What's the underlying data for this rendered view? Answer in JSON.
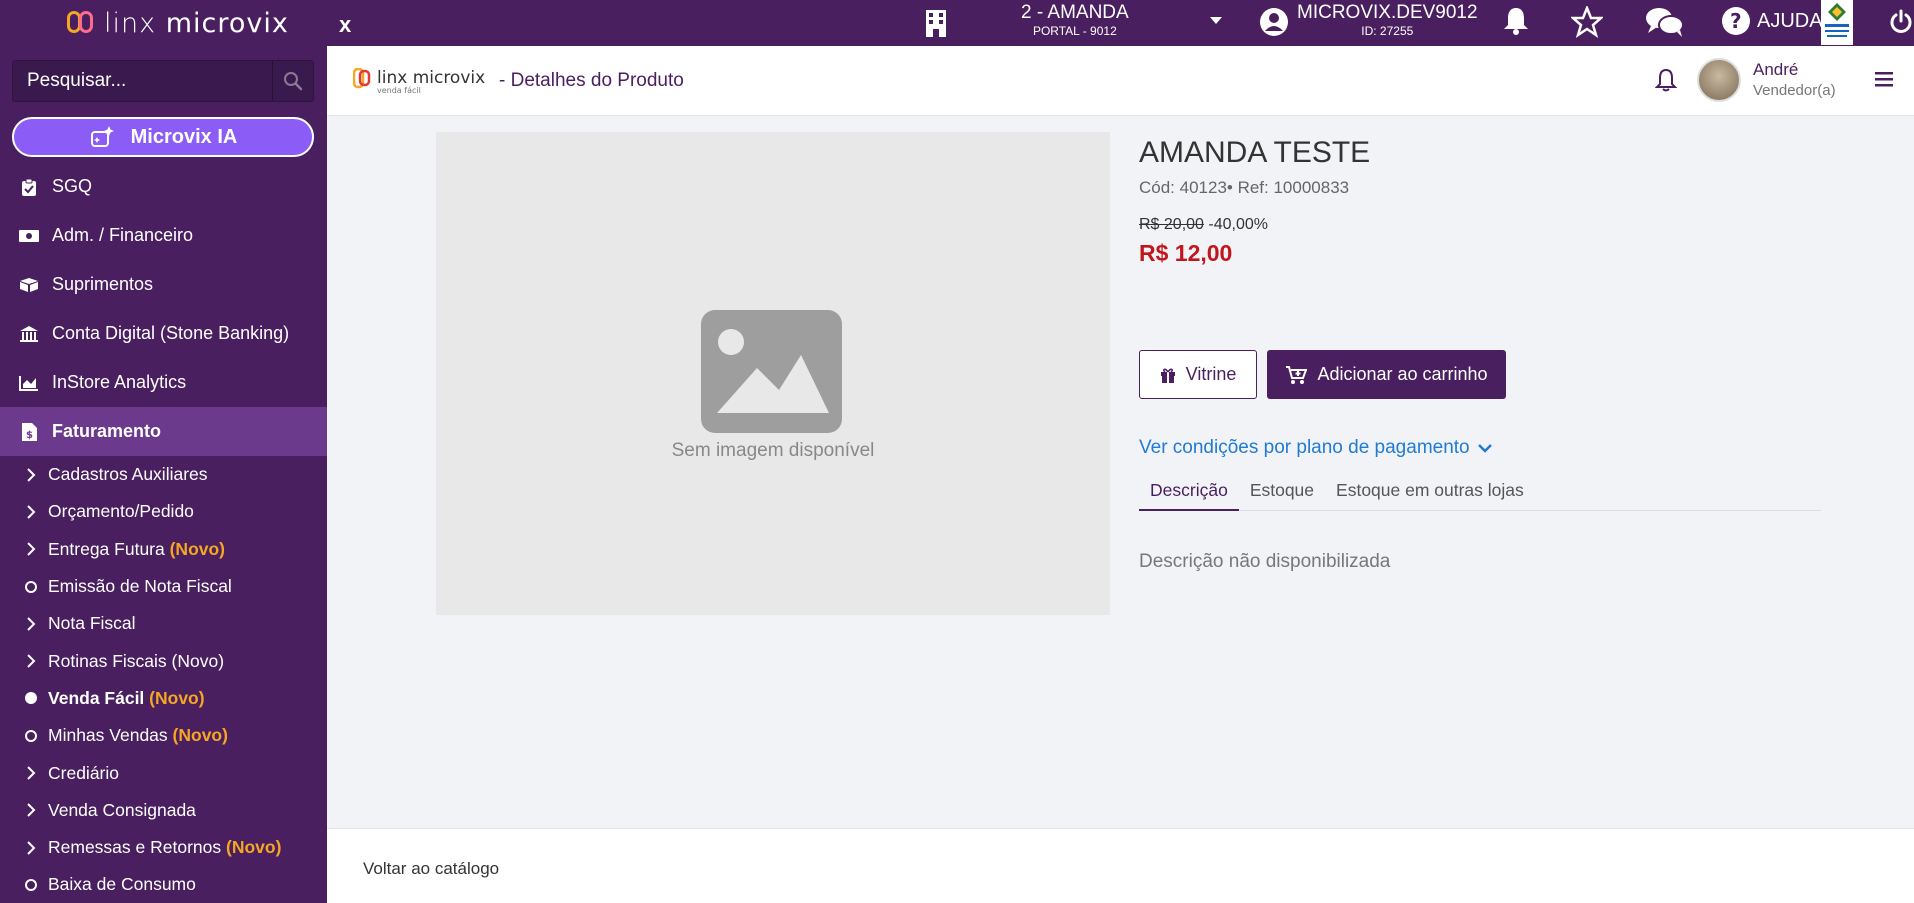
{
  "sidebar": {
    "logo_text_light": "linx",
    "logo_text_bold": "microvix",
    "search_placeholder": "Pesquisar...",
    "ia_label": "Microvix IA",
    "items": [
      {
        "label": "SGQ",
        "icon": "clipboard-check-icon"
      },
      {
        "label": "Adm. / Financeiro",
        "icon": "money-bill-icon"
      },
      {
        "label": "Suprimentos",
        "icon": "boxes-icon"
      },
      {
        "label": "Conta Digital (Stone Banking)",
        "icon": "bank-icon"
      },
      {
        "label": "InStore Analytics",
        "icon": "chart-area-icon"
      },
      {
        "label": "Faturamento",
        "icon": "invoice-icon"
      }
    ],
    "sub_items": [
      {
        "label": "Cadastros Auxiliares",
        "novo": ""
      },
      {
        "label": "Orçamento/Pedido",
        "novo": ""
      },
      {
        "label": "Entrega Futura",
        "novo": "(Novo)"
      },
      {
        "label": "Emissão de Nota Fiscal",
        "novo": ""
      },
      {
        "label": "Nota Fiscal",
        "novo": ""
      },
      {
        "label": "Rotinas Fiscais (Novo)",
        "novo": ""
      },
      {
        "label": "Venda Fácil",
        "novo": "(Novo)"
      },
      {
        "label": "Minhas Vendas",
        "novo": "(Novo)"
      },
      {
        "label": "Crediário",
        "novo": ""
      },
      {
        "label": "Venda Consignada",
        "novo": ""
      },
      {
        "label": "Remessas e Retornos",
        "novo": "(Novo)"
      },
      {
        "label": "Baixa de Consumo",
        "novo": ""
      }
    ]
  },
  "topbar": {
    "close_label": "x",
    "store_name": "2 - AMANDA",
    "store_portal": "PORTAL - 9012",
    "user_login": "MICROVIX.DEV9012",
    "user_id": "ID: 27255",
    "help_label": "AJUDA"
  },
  "header": {
    "logo_light": "linx",
    "logo_bold": "microvix",
    "logo_sub": "venda fácil",
    "title": "-  Detalhes do Produto",
    "user_name": "André",
    "user_role": "Vendedor(a)"
  },
  "product": {
    "no_image": "Sem imagem disponível",
    "name": "AMANDA TESTE",
    "code": "Cód: 40123• Ref: 10000833",
    "old_price": "R$ 20,00",
    "discount": "-40,00%",
    "price": "R$ 12,00",
    "btn_vitrine": "Vitrine",
    "btn_cart": "Adicionar ao carrinho",
    "conditions_link": "Ver condições por plano de pagamento",
    "tabs": [
      "Descrição",
      "Estoque",
      "Estoque em outras lojas"
    ],
    "description": "Descrição não disponibilizada"
  },
  "footer": {
    "back_link": "Voltar ao catálogo"
  },
  "colors": {
    "primary": "#4a1f5f",
    "accent_ia": "#8b5cf6",
    "novo": "#f5a623",
    "price": "#c0161c",
    "link": "#1f7bd4"
  }
}
